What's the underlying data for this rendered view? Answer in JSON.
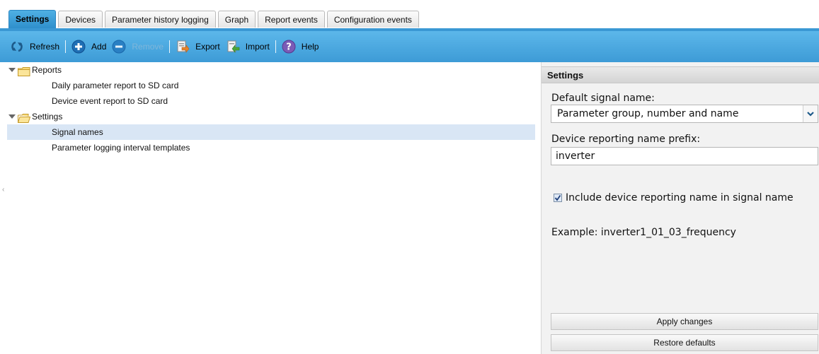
{
  "tabs": [
    {
      "label": "Settings",
      "active": true
    },
    {
      "label": "Devices"
    },
    {
      "label": "Parameter history logging"
    },
    {
      "label": "Graph"
    },
    {
      "label": "Report events"
    },
    {
      "label": "Configuration events"
    }
  ],
  "toolbar": {
    "refresh_label": "Refresh",
    "add_label": "Add",
    "remove_label": "Remove",
    "export_label": "Export",
    "import_label": "Import",
    "help_label": "Help"
  },
  "tree": {
    "reports_label": "Reports",
    "reports_items": [
      "Daily parameter report to SD card",
      "Device event report to SD card"
    ],
    "settings_label": "Settings",
    "settings_items": [
      "Signal names",
      "Parameter logging interval templates"
    ],
    "selected": "Signal names"
  },
  "panel": {
    "title": "Settings",
    "default_signal_label": "Default signal name:",
    "default_signal_value": "Parameter group, number and name",
    "prefix_label": "Device reporting name prefix:",
    "prefix_value": "inverter",
    "include_checkbox_label": "Include device reporting name in signal name",
    "include_checked": true,
    "example_text": "Example: inverter1_01_03_frequency",
    "apply_label": "Apply changes",
    "restore_label": "Restore defaults"
  },
  "colors": {
    "toolbar": "#4aa8e0",
    "selection": "#d9e6f5",
    "panel_bg": "#f2f2f2"
  }
}
